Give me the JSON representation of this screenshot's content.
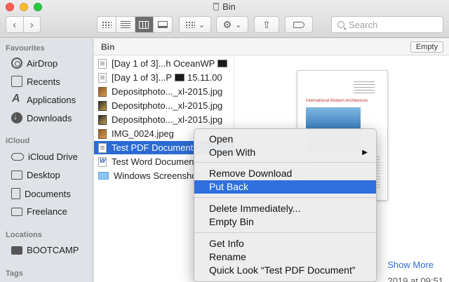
{
  "window": {
    "title": "Bin"
  },
  "toolbar": {
    "back_symbol": "‹",
    "forward_symbol": "›",
    "group_dropdown_symbol": "⌄",
    "action_symbol": "⚙",
    "action_dropdown_symbol": "⌄",
    "share_symbol": "⇧",
    "search_placeholder": "Search"
  },
  "sidebar": {
    "sections": [
      {
        "heading": "Favourites"
      },
      {
        "heading": "iCloud"
      },
      {
        "heading": "Locations"
      },
      {
        "heading": "Tags"
      }
    ],
    "items": [
      {
        "label": "AirDrop",
        "icon": "airdrop-icon"
      },
      {
        "label": "Recents",
        "icon": "recents-icon"
      },
      {
        "label": "Applications",
        "icon": "applications-icon"
      },
      {
        "label": "Downloads",
        "icon": "downloads-icon"
      },
      {
        "label": "iCloud Drive",
        "icon": "cloud-icon"
      },
      {
        "label": "Desktop",
        "icon": "desktop-icon"
      },
      {
        "label": "Documents",
        "icon": "document-icon"
      },
      {
        "label": "Freelance",
        "icon": "folder-icon"
      },
      {
        "label": "BOOTCAMP",
        "icon": "drive-icon"
      }
    ]
  },
  "pathbar": {
    "folder": "Bin",
    "empty_button": "Empty"
  },
  "files": [
    {
      "name": "[Day 1 of 3]...h OceanWP",
      "icon": "document-icon"
    },
    {
      "name": "[Day 1 of 3]...P",
      "suffix": "15.11.00",
      "icon": "document-icon"
    },
    {
      "name": "Depositphoto..._xl-2015.jpg",
      "icon": "image-icon"
    },
    {
      "name": "Depositphoto..._xl-2015.jpg",
      "icon": "image-icon"
    },
    {
      "name": "Depositphoto..._xl-2015.jpg",
      "icon": "image-icon"
    },
    {
      "name": "IMG_0024.jpeg",
      "icon": "image-icon"
    },
    {
      "name": "Test PDF Document",
      "icon": "pdf-icon",
      "selected": true
    },
    {
      "name": "Test Word Document",
      "icon": "word-icon"
    },
    {
      "name": "Windows Screenshot",
      "icon": "folder-icon"
    }
  ],
  "preview": {
    "doc_title": "International Modern Architecture",
    "show_more": "Show More",
    "date_peek": "2019 at 09:51"
  },
  "context_menu": {
    "items": [
      {
        "label": "Open"
      },
      {
        "label": "Open With",
        "submenu_symbol": "▶"
      },
      {
        "label": "Remove Download"
      },
      {
        "label": "Put Back",
        "highlighted": true
      },
      {
        "label": "Delete Immediately..."
      },
      {
        "label": "Empty Bin"
      },
      {
        "label": "Get Info"
      },
      {
        "label": "Rename"
      },
      {
        "label": "Quick Look “Test PDF Document”"
      }
    ]
  },
  "colors": {
    "selection": "#2a6bd3",
    "menu_highlight": "#2f6fde",
    "link": "#2e6ad4"
  }
}
